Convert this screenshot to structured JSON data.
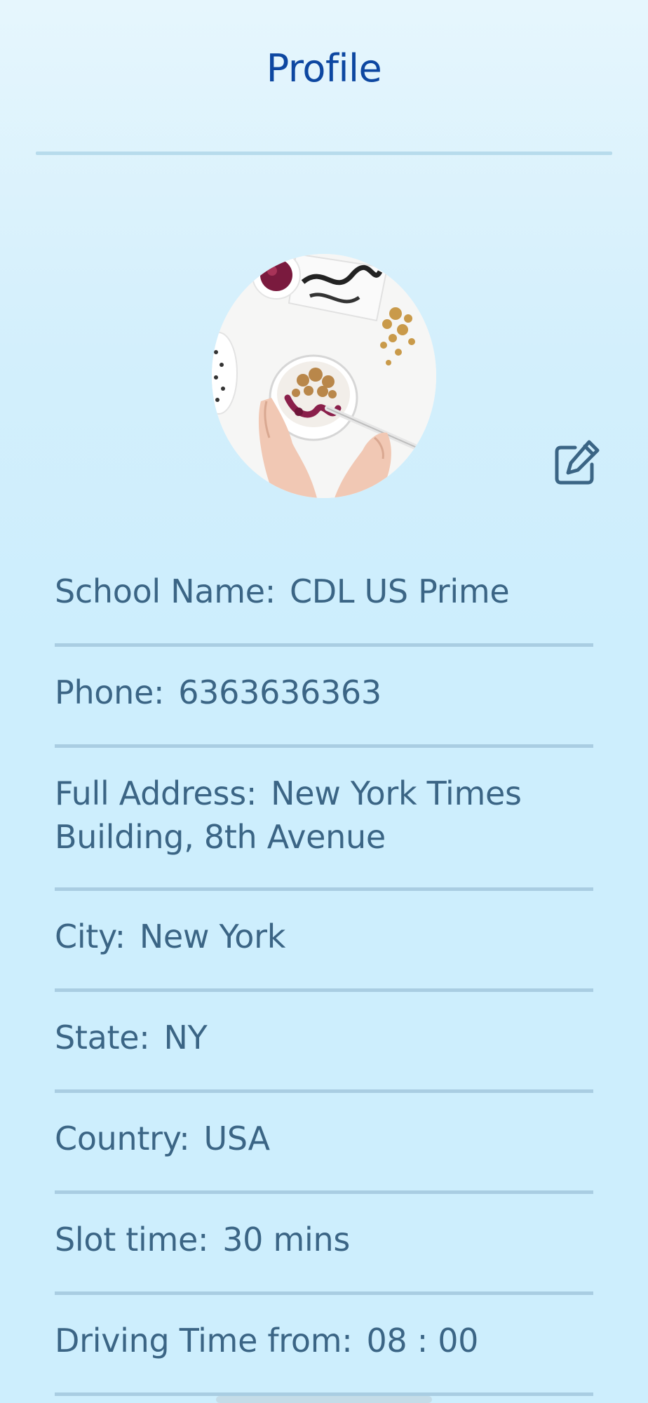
{
  "header": {
    "title": "Profile"
  },
  "avatar": {
    "icon": "profile-photo-image"
  },
  "edit": {
    "icon": "edit-icon"
  },
  "fields": {
    "school_name": {
      "label": "School Name:",
      "value": "CDL US Prime"
    },
    "phone": {
      "label": "Phone:",
      "value": "6363636363"
    },
    "address": {
      "label": "Full Address:",
      "value": "New York Times Building, 8th Avenue"
    },
    "city": {
      "label": "City:",
      "value": "New York"
    },
    "state": {
      "label": "State:",
      "value": "NY"
    },
    "country": {
      "label": "Country:",
      "value": "USA"
    },
    "slot_time": {
      "label": "Slot time:",
      "value": "30 mins"
    },
    "driving_from": {
      "label": "Driving Time from:",
      "value": "08 : 00"
    }
  },
  "colors": {
    "title": "#0d47a1",
    "text": "#3b6585",
    "divider": "#a9cde2",
    "background": "#cdeefd"
  }
}
